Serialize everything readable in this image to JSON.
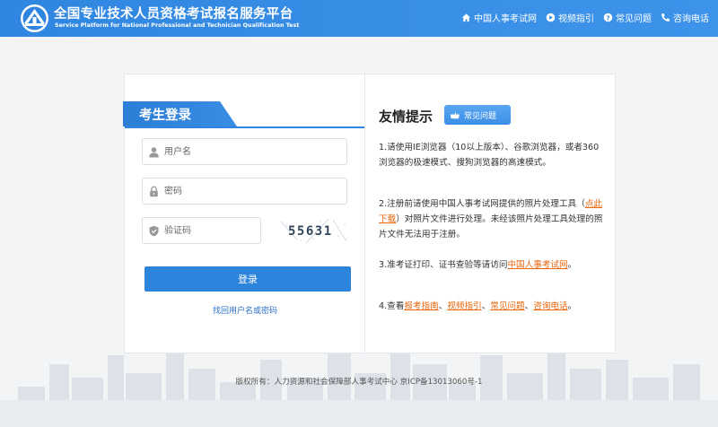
{
  "header": {
    "title_cn": "全国专业技术人员资格考试报名服务平台",
    "title_en": "Service Platform for National Professional and Technician Qualification Test",
    "nav": [
      {
        "label": "中国人事考试网",
        "icon": "home-icon"
      },
      {
        "label": "视频指引",
        "icon": "video-icon"
      },
      {
        "label": "常见问题",
        "icon": "question-icon"
      },
      {
        "label": "咨询电话",
        "icon": "phone-icon"
      }
    ]
  },
  "login": {
    "tab_label": "考生登录",
    "username_placeholder": "用户名",
    "password_placeholder": "密码",
    "captcha_placeholder": "验证码",
    "captcha_text": "55631",
    "login_button": "登录",
    "recover_link": "找回用户名或密码"
  },
  "tips": {
    "title": "友情提示",
    "faq_button": "常见问题",
    "tip1": "1.请使用IE浏览器（10以上版本）、谷歌浏览器，或者360浏览器的极速模式、搜狗浏览器的高速模式。",
    "tip2_a": "2.注册前请使用中国人事考试网提供的照片处理工具（",
    "tip2_link": "点此下载",
    "tip2_b": "）对照片文件进行处理。未经该照片处理工具处理的照片文件无法用于注册。",
    "tip3_a": "3.准考证打印、证书查验等请访问",
    "tip3_link": "中国人事考试网",
    "tip3_b": "。",
    "tip4_a": "4.查看",
    "tip4_link1": "报考指南",
    "tip4_sep1": "、",
    "tip4_link2": "视频指引",
    "tip4_sep2": "、",
    "tip4_link3": "常见问题",
    "tip4_sep3": "、",
    "tip4_link4": "咨询电话",
    "tip4_b": "。"
  },
  "footer": {
    "text": "版权所有：人力资源和社会保障部人事考试中心 京ICP备13013060号-1"
  },
  "colors": {
    "primary": "#2f86e0",
    "link_orange": "#e8650c",
    "link_blue": "#2d6fc8"
  }
}
